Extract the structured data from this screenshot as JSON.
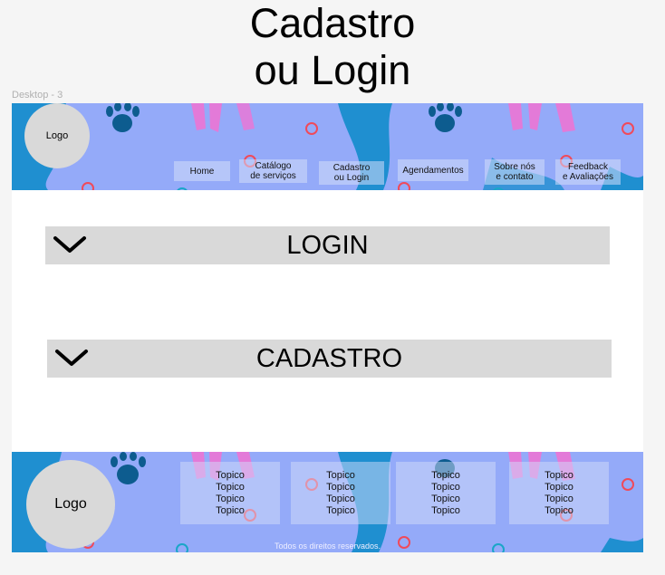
{
  "title": {
    "line1": "Cadastro",
    "line2": "ou Login"
  },
  "frame_label": "Desktop - 3",
  "header": {
    "logo": "Logo",
    "nav": [
      {
        "line1": "Home",
        "line2": ""
      },
      {
        "line1": "Catálogo",
        "line2": "de serviços"
      },
      {
        "line1": "Cadastro",
        "line2": "ou Login"
      },
      {
        "line1": "Agendamentos",
        "line2": ""
      },
      {
        "line1": "Sobre nós",
        "line2": "e contato"
      },
      {
        "line1": "Feedback",
        "line2": "e Avaliações"
      }
    ]
  },
  "sections": [
    {
      "label": "LOGIN",
      "icon": "chevron-down-icon"
    },
    {
      "label": "CADASTRO",
      "icon": "chevron-down-icon"
    }
  ],
  "footer": {
    "logo": "Logo",
    "columns": [
      [
        "Topico",
        "Topico",
        "Topico",
        "Topico"
      ],
      [
        "Topico",
        "Topico",
        "Topico",
        "Topico"
      ],
      [
        "Topico",
        "Topico",
        "Topico",
        "Topico"
      ],
      [
        "Topico",
        "Topico",
        "Topico",
        "Topico"
      ]
    ],
    "copyright": "Todos os direitos reservados."
  },
  "colors": {
    "pattern_bg": "#94aaf9",
    "blue_shape": "#1f8fd0",
    "paw": "#0d5c8f",
    "pink_legs": "#e37ad8",
    "ring_red": "#f04a5a",
    "ring_teal": "#1aa6c8",
    "accordion_bg": "#d9d9d9"
  }
}
